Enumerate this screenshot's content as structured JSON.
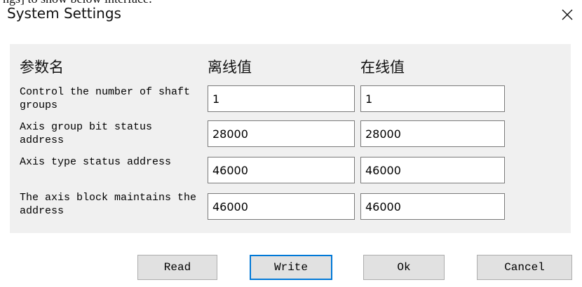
{
  "fragment_text": "ngs] to show below interface:",
  "dialog": {
    "title": "System Settings",
    "close_glyph": "×"
  },
  "table": {
    "headers": {
      "param": "参数名",
      "offline": "离线值",
      "online": "在线值"
    },
    "rows": [
      {
        "label": "Control the number of shaft groups",
        "offline": "1",
        "online": "1"
      },
      {
        "label": "Axis group bit status address",
        "offline": "28000",
        "online": "28000"
      },
      {
        "label": "Axis type status address",
        "offline": "46000",
        "online": "46000"
      },
      {
        "label": "The axis block maintains the address",
        "offline": "46000",
        "online": "46000"
      }
    ]
  },
  "buttons": {
    "read": "Read",
    "write": "Write",
    "ok": "Ok",
    "cancel": "Cancel"
  }
}
